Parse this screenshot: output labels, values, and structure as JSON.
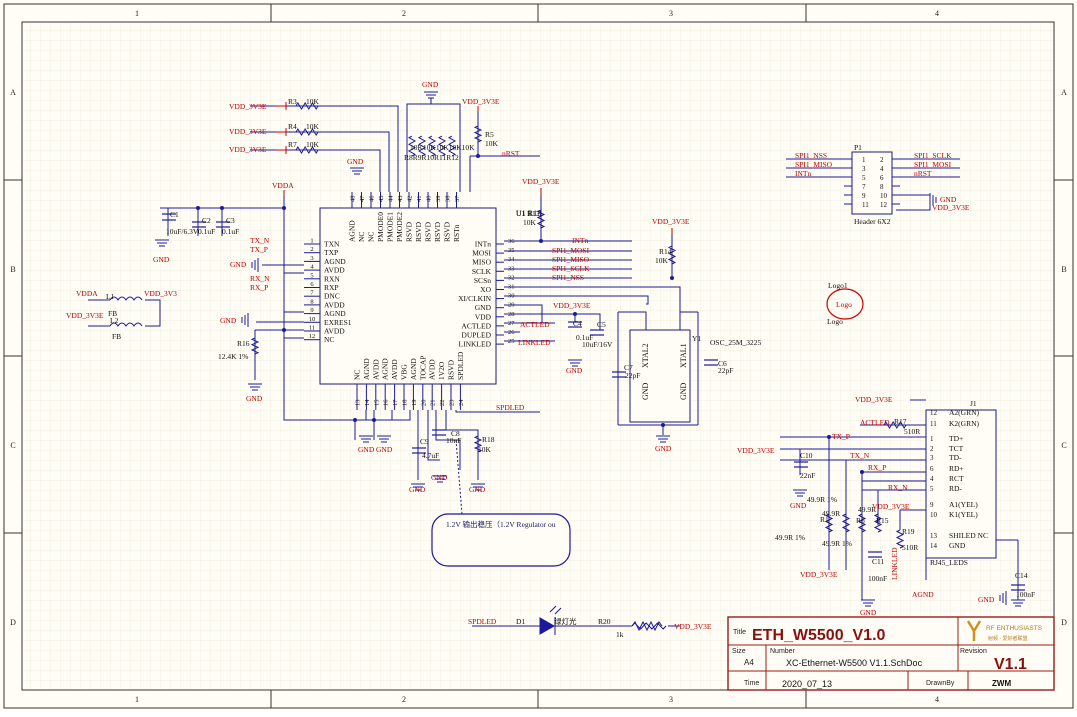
{
  "sheet": {
    "col_labels": [
      "1",
      "2",
      "3",
      "4"
    ],
    "row_labels": [
      "A",
      "B",
      "C",
      "D"
    ]
  },
  "chip": {
    "designator": "U1",
    "top_pins": [
      {
        "num": "48",
        "name": "AGND"
      },
      {
        "num": "47",
        "name": "NC"
      },
      {
        "num": "46",
        "name": "NC"
      },
      {
        "num": "45",
        "name": "PMODE0"
      },
      {
        "num": "44",
        "name": "PMODE1"
      },
      {
        "num": "43",
        "name": "PMODE2"
      },
      {
        "num": "42",
        "name": "RSVD"
      },
      {
        "num": "41",
        "name": "RSVD"
      },
      {
        "num": "40",
        "name": "RSVD"
      },
      {
        "num": "39",
        "name": "RSVD"
      },
      {
        "num": "38",
        "name": "RSVD"
      },
      {
        "num": "37",
        "name": "RSTn"
      }
    ],
    "left_pins": [
      {
        "num": "1",
        "name": "TXN"
      },
      {
        "num": "2",
        "name": "TXP"
      },
      {
        "num": "3",
        "name": "AGND"
      },
      {
        "num": "4",
        "name": "AVDD"
      },
      {
        "num": "5",
        "name": "RXN"
      },
      {
        "num": "6",
        "name": "RXP"
      },
      {
        "num": "7",
        "name": "DNC"
      },
      {
        "num": "8",
        "name": "AVDD"
      },
      {
        "num": "9",
        "name": "AGND"
      },
      {
        "num": "10",
        "name": "EXRES1"
      },
      {
        "num": "11",
        "name": "AVDD"
      },
      {
        "num": "12",
        "name": "NC"
      }
    ],
    "right_pins": [
      {
        "num": "36",
        "name": "INTn"
      },
      {
        "num": "35",
        "name": "MOSI"
      },
      {
        "num": "34",
        "name": "MISO"
      },
      {
        "num": "33",
        "name": "SCLK"
      },
      {
        "num": "32",
        "name": "SCSn"
      },
      {
        "num": "31",
        "name": "XO"
      },
      {
        "num": "30",
        "name": "XI/CLKIN"
      },
      {
        "num": "29",
        "name": "GND"
      },
      {
        "num": "28",
        "name": "VDD"
      },
      {
        "num": "27",
        "name": "ACTLED"
      },
      {
        "num": "26",
        "name": "DUPLED"
      },
      {
        "num": "25",
        "name": "LINKLED"
      }
    ],
    "bottom_pins": [
      {
        "num": "13",
        "name": "NC"
      },
      {
        "num": "14",
        "name": "AGND"
      },
      {
        "num": "15",
        "name": "AVDD"
      },
      {
        "num": "16",
        "name": "AGND"
      },
      {
        "num": "17",
        "name": "AVDD"
      },
      {
        "num": "18",
        "name": "VBG"
      },
      {
        "num": "19",
        "name": "AGND"
      },
      {
        "num": "20",
        "name": "TOCAP"
      },
      {
        "num": "21",
        "name": "AVDD"
      },
      {
        "num": "22",
        "name": "1V2O"
      },
      {
        "num": "23",
        "name": "RSVD"
      },
      {
        "num": "24",
        "name": "SPDLED"
      }
    ]
  },
  "resistors_top": [
    {
      "ref": "R3",
      "value": "10K",
      "net": "VDD_3V3E"
    },
    {
      "ref": "R4",
      "value": "10K",
      "net": "VDD_3V3E"
    },
    {
      "ref": "R7",
      "value": "10K",
      "net": "VDD_3V3E"
    }
  ],
  "pulldown_labels": {
    "refs": "R8R9R10R11R12",
    "values": "10K10K10K10K10K"
  },
  "labels": {
    "gnd": "GND",
    "vdd_3v3e": "VDD_3V3E",
    "vdd_3v3": "VDD_3V3",
    "vdda": "VDDA",
    "nrst": "nRST",
    "r5": "R5",
    "r5v": "10K",
    "r13": "U1 R13",
    "r13v": "10K",
    "r14": "R14",
    "r14v": "10K",
    "c1": "C1",
    "c1v": "10uF/6.3V",
    "c2": "C2",
    "c2v": "0.1uF",
    "c3": "C3",
    "c3v": "0.1uF",
    "l1": "L1",
    "l2": "L2",
    "fb": "FB",
    "r16": "R16",
    "r16v": "12.4K 1%",
    "c4": "C4",
    "c4v": "0.1uF",
    "c5": "C5",
    "c5v": "10uF/16V",
    "c7": "C7",
    "c7v": "22pF",
    "c6": "C6",
    "c6v": "22pF",
    "c8": "C8",
    "c8v": "10nF",
    "c9": "C9",
    "c9v": "4.7uF",
    "r18": "R18",
    "r18v": "10K",
    "y1": "Y1",
    "osc": "OSC_25M_3225",
    "xtal2": "XTAL2",
    "xtal1": "XTAL1",
    "tx_n": "TX_N",
    "tx_p": "TX_P",
    "rx_n": "RX_N",
    "rx_p": "RX_P",
    "intn": "INTn",
    "spi_mosi": "SPI1_MOSI",
    "spi_miso": "SPI1_MISO",
    "spi_sclk": "SPI1_SCLK",
    "spi_nss": "SPI1_NSS",
    "actled": "ACTLED",
    "linkled": "LINKLED",
    "spdled": "SPDLED",
    "logo1": "Logo1",
    "logo": "Logo",
    "p1": "P1",
    "header": "Header 6X2",
    "j1": "J1",
    "rj45": "RJ45_LEDS",
    "shield": "SHILED NC",
    "r17": "R17",
    "r17v": "510R",
    "r19": "R19",
    "r19v": "510R",
    "c10": "C10",
    "c10v": "22nF",
    "c11": "C11",
    "c11v": "100nF",
    "c14": "C14",
    "c14v": "100nF",
    "r1": "R1",
    "r6": "R6",
    "r15": "R15",
    "r_49": "49.9R 1%",
    "r_49b": "49.9R",
    "agnd": "AGND",
    "d1": "D1",
    "d1name": "绿灯光",
    "r20": "R20",
    "r20v": "1k",
    "note": "1.2V 输出稳压（1.2V Regulator ou"
  },
  "header_pins": {
    "left_nums": [
      "1",
      "3",
      "5",
      "7",
      "9",
      "11"
    ],
    "right_nums": [
      "2",
      "4",
      "6",
      "8",
      "10",
      "12"
    ],
    "left_nets": [
      "SPI1_NSS",
      "SPI1_MISO",
      "INTn"
    ],
    "right_nets": [
      "SPI1_SCLK",
      "SPI1_MOSI",
      "nRST"
    ]
  },
  "j1_pins": [
    {
      "num": "12",
      "name": "A2(GRN)"
    },
    {
      "num": "11",
      "name": "K2(GRN)"
    },
    {
      "num": "1",
      "name": "TD+"
    },
    {
      "num": "2",
      "name": "TCT"
    },
    {
      "num": "3",
      "name": "TD-"
    },
    {
      "num": "6",
      "name": "RD+"
    },
    {
      "num": "4",
      "name": "RCT"
    },
    {
      "num": "5",
      "name": "RD-"
    },
    {
      "num": "9",
      "name": "A1(YEL)"
    },
    {
      "num": "10",
      "name": "K1(YEL)"
    },
    {
      "num": "13",
      "name": "SHILED NC"
    },
    {
      "num": "14",
      "name": "GND"
    }
  ],
  "title_block": {
    "title_label": "Title",
    "title": "ETH_W5500_V1.0",
    "size_label": "Size",
    "size": "A4",
    "number_label": "Number",
    "number": "XC-Ethernet-W5500 V1.1.SchDoc",
    "revision_label": "Revision",
    "revision": "V1.1",
    "time_label": "Time",
    "time": "2020_07_13",
    "drawnby_label": "DrawnBy",
    "drawnby": "ZWM",
    "brand": "RF ENTHUSIASTS",
    "brand_sub": "射频 · 爱好者联盟"
  }
}
